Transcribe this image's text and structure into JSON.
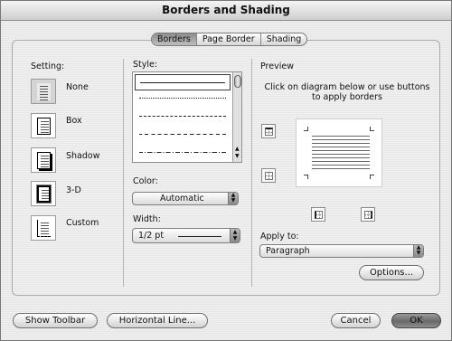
{
  "window": {
    "title": "Borders and Shading"
  },
  "tabs": [
    {
      "label": "Borders",
      "active": true
    },
    {
      "label": "Page Border",
      "active": false
    },
    {
      "label": "Shading",
      "active": false
    }
  ],
  "setting": {
    "heading": "Setting:",
    "options": [
      {
        "label": "None",
        "icon": "none-setting-icon",
        "selected": true
      },
      {
        "label": "Box",
        "icon": "box-setting-icon"
      },
      {
        "label": "Shadow",
        "icon": "shadow-setting-icon"
      },
      {
        "label": "3-D",
        "icon": "3d-setting-icon"
      },
      {
        "label": "Custom",
        "icon": "custom-setting-icon"
      }
    ]
  },
  "style": {
    "heading": "Style:",
    "options": [
      "solid",
      "dotted",
      "dashed-small",
      "dashed",
      "dash-dot"
    ],
    "selected_index": 0
  },
  "color": {
    "label": "Color:",
    "value": "Automatic"
  },
  "width": {
    "label": "Width:",
    "value": "1/2 pt"
  },
  "preview": {
    "heading": "Preview",
    "instructions": "Click on diagram below or use buttons to apply borders"
  },
  "apply_to": {
    "label": "Apply to:",
    "value": "Paragraph"
  },
  "buttons": {
    "options": "Options...",
    "show_toolbar": "Show Toolbar",
    "horizontal_line": "Horizontal Line...",
    "cancel": "Cancel",
    "ok": "OK"
  }
}
